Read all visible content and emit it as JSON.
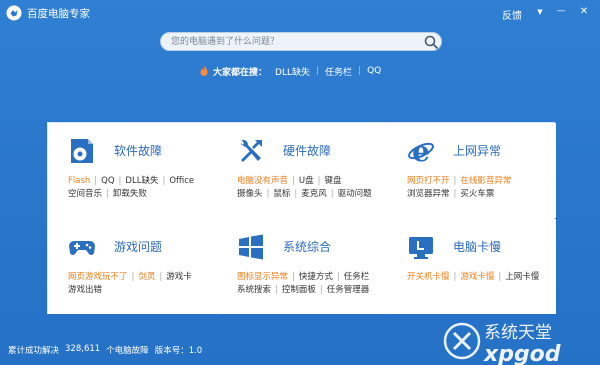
{
  "titlebar": {
    "title": "百度电脑专家",
    "feedback": "反馈",
    "menu_glyph": "▼",
    "minimize_glyph": "—",
    "close_glyph": "✕"
  },
  "search": {
    "placeholder": "您的电脑遇到了什么问题？"
  },
  "hot": {
    "label": "大家都在搜：",
    "links": [
      "DLL缺失",
      "任务栏",
      "QQ"
    ]
  },
  "cards": [
    {
      "title": "软件故障",
      "icon": "software-icon",
      "rows": [
        [
          {
            "t": "Flash",
            "o": true
          },
          {
            "t": "QQ"
          },
          {
            "t": "DLL缺失"
          },
          {
            "t": "Office"
          }
        ],
        [
          {
            "t": "空间音乐"
          },
          {
            "t": "卸载失败"
          }
        ]
      ]
    },
    {
      "title": "硬件故障",
      "icon": "tools-icon",
      "rows": [
        [
          {
            "t": "电脑没有声音",
            "o": true
          },
          {
            "t": "U盘"
          },
          {
            "t": "键盘"
          }
        ],
        [
          {
            "t": "摄像头"
          },
          {
            "t": "鼠标"
          },
          {
            "t": "麦克风"
          },
          {
            "t": "驱动问题"
          }
        ]
      ]
    },
    {
      "title": "上网异常",
      "icon": "ie-icon",
      "rows": [
        [
          {
            "t": "网页打不开",
            "o": true
          },
          {
            "t": "在线影音异常",
            "o": true
          }
        ],
        [
          {
            "t": "浏览器异常"
          },
          {
            "t": "买火车票"
          }
        ]
      ]
    },
    {
      "title": "游戏问题",
      "icon": "gamepad-icon",
      "rows": [
        [
          {
            "t": "网页游戏玩不了",
            "o": true
          },
          {
            "t": "剑灵",
            "o": true
          },
          {
            "t": "游戏卡"
          }
        ],
        [
          {
            "t": "游戏出错"
          }
        ]
      ]
    },
    {
      "title": "系统综合",
      "icon": "windows-icon",
      "rows": [
        [
          {
            "t": "图标显示异常",
            "o": true
          },
          {
            "t": "快捷方式"
          },
          {
            "t": "任务栏"
          }
        ],
        [
          {
            "t": "系统搜索"
          },
          {
            "t": "控制面板"
          },
          {
            "t": "任务管理器"
          }
        ]
      ]
    },
    {
      "title": "电脑卡慢",
      "icon": "monitor-icon",
      "rows": [
        [
          {
            "t": "开关机卡慢",
            "o": true
          },
          {
            "t": "游戏卡慢",
            "o": true
          },
          {
            "t": "上网卡慢"
          }
        ]
      ]
    }
  ],
  "status": {
    "solved_label": "累计成功解决",
    "solved_count": "328,611",
    "solved_suffix": "个电脑故障",
    "version": "版本号：1.0"
  },
  "watermark": {
    "line1": "系统天堂",
    "line2": "xpgod"
  },
  "colors": {
    "background": "#2a77cc",
    "card_title": "#2d6bb8",
    "highlight": "#ee7e1a",
    "icon_blue": "#2a6fc0"
  }
}
